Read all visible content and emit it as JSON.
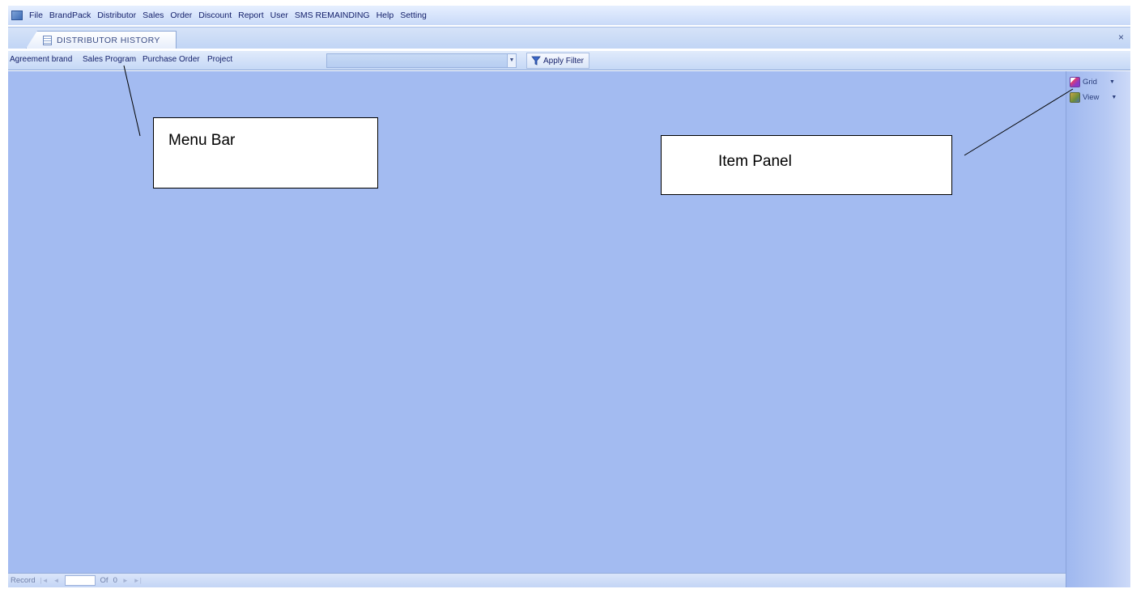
{
  "menubar": {
    "items": [
      "File",
      "BrandPack",
      "Distributor",
      "Sales",
      "Order",
      "Discount",
      "Report",
      "User",
      "SMS REMAINDING",
      "Help",
      "Setting"
    ]
  },
  "tab": {
    "label": "DISTRIBUTOR HISTORY",
    "close_glyph": "×"
  },
  "subbar": {
    "items": [
      "Agreement brand",
      "Sales Program",
      "Purchase Order",
      "Project"
    ],
    "combo_arrow": "▼",
    "apply_filter_label": "Apply Filter"
  },
  "item_panel": {
    "buttons": [
      {
        "label": "Grid",
        "icon": "grid-icon"
      },
      {
        "label": "View",
        "icon": "view-icon"
      }
    ],
    "dropdown_glyph": "▼"
  },
  "statusbar": {
    "record_label": "Record",
    "first": "|◄",
    "prev": "◄",
    "of_label": "Of",
    "count": "0",
    "next": "►",
    "last": "►|"
  },
  "annotations": {
    "menu_bar": "Menu Bar",
    "item_panel": "Item Panel"
  },
  "colors": {
    "canvas": "#a3bbf1",
    "menubar": "#c9daf8",
    "text": "#15216b"
  }
}
